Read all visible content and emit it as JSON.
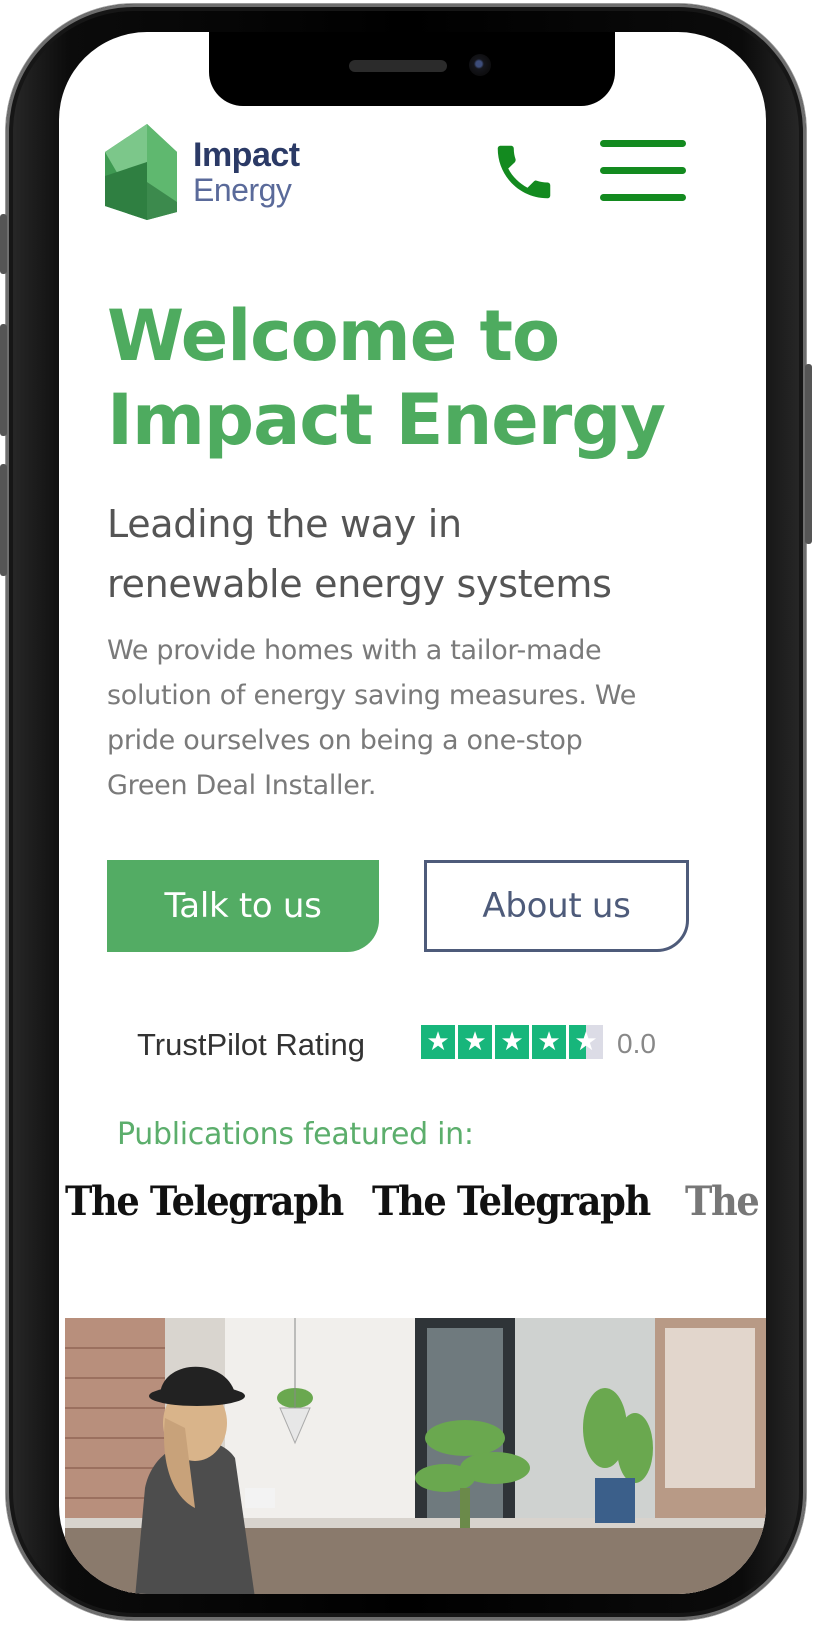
{
  "header": {
    "logo_line1": "Impact",
    "logo_line2": "Energy"
  },
  "hero": {
    "title_line1": "Welcome to",
    "title_line2": "Impact Energy",
    "subtitle_line1": "Leading the way in",
    "subtitle_line2": "renewable energy systems",
    "body_line1": "We provide homes with a tailor-made",
    "body_line2": "solution of energy saving measures. We",
    "body_line3": "pride ourselves on being a one-stop",
    "body_line4": "Green Deal Installer."
  },
  "buttons": {
    "primary_label": "Talk to us",
    "secondary_label": "About us"
  },
  "trustpilot": {
    "label": "TrustPilot Rating",
    "score": "0.0",
    "stars_filled": 4.5,
    "stars_total": 5
  },
  "publications": {
    "heading": "Publications featured in:",
    "logos": [
      "The Telegraph",
      "The Telegraph",
      "The Telegraph"
    ]
  },
  "colors": {
    "brand_green": "#4eab5f",
    "nav_green": "#138a1f",
    "brand_navy": "#2b3a66",
    "trustpilot_green": "#17b67b"
  },
  "icons": {
    "logo": "house-logo-icon",
    "call": "phone-icon",
    "menu": "hamburger-menu-icon",
    "star": "star-icon"
  }
}
